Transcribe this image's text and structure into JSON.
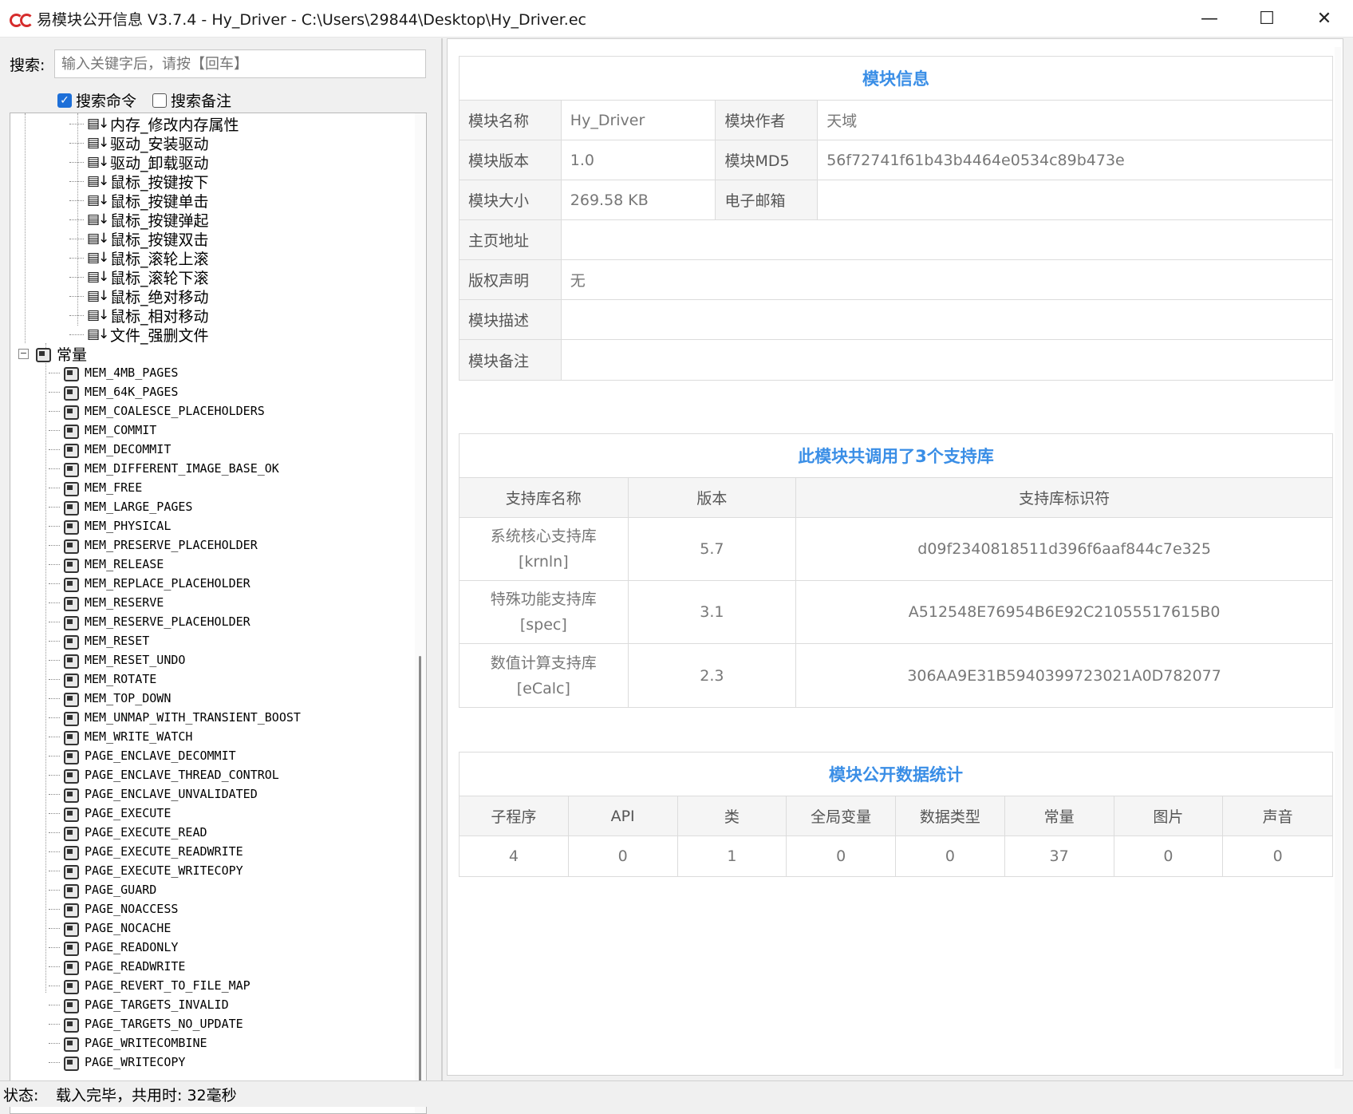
{
  "window": {
    "title": "易模块公开信息 V3.7.4 - Hy_Driver - C:\\Users\\29844\\Desktop\\Hy_Driver.ec",
    "minimize": "—",
    "maximize": "☐",
    "close": "✕"
  },
  "search": {
    "label": "搜索:",
    "placeholder": "输入关键字后，请按【回车】",
    "opt_cmd": "搜索命令",
    "opt_cmd_checked": true,
    "opt_note": "搜索备注",
    "opt_note_checked": false
  },
  "tree": {
    "commands": [
      "内存_修改内存属性",
      "驱动_安装驱动",
      "驱动_卸载驱动",
      "鼠标_按键按下",
      "鼠标_按键单击",
      "鼠标_按键弹起",
      "鼠标_按键双击",
      "鼠标_滚轮上滚",
      "鼠标_滚轮下滚",
      "鼠标_绝对移动",
      "鼠标_相对移动",
      "文件_强删文件"
    ],
    "const_group": "常量",
    "constants": [
      "MEM_4MB_PAGES",
      "MEM_64K_PAGES",
      "MEM_COALESCE_PLACEHOLDERS",
      "MEM_COMMIT",
      "MEM_DECOMMIT",
      "MEM_DIFFERENT_IMAGE_BASE_OK",
      "MEM_FREE",
      "MEM_LARGE_PAGES",
      "MEM_PHYSICAL",
      "MEM_PRESERVE_PLACEHOLDER",
      "MEM_RELEASE",
      "MEM_REPLACE_PLACEHOLDER",
      "MEM_RESERVE",
      "MEM_RESERVE_PLACEHOLDER",
      "MEM_RESET",
      "MEM_RESET_UNDO",
      "MEM_ROTATE",
      "MEM_TOP_DOWN",
      "MEM_UNMAP_WITH_TRANSIENT_BOOST",
      "MEM_WRITE_WATCH",
      "PAGE_ENCLAVE_DECOMMIT",
      "PAGE_ENCLAVE_THREAD_CONTROL",
      "PAGE_ENCLAVE_UNVALIDATED",
      "PAGE_EXECUTE",
      "PAGE_EXECUTE_READ",
      "PAGE_EXECUTE_READWRITE",
      "PAGE_EXECUTE_WRITECOPY",
      "PAGE_GUARD",
      "PAGE_NOACCESS",
      "PAGE_NOCACHE",
      "PAGE_READONLY",
      "PAGE_READWRITE",
      "PAGE_REVERT_TO_FILE_MAP",
      "PAGE_TARGETS_INVALID",
      "PAGE_TARGETS_NO_UPDATE",
      "PAGE_WRITECOMBINE",
      "PAGE_WRITECOPY"
    ]
  },
  "module_info": {
    "title": "模块信息",
    "name_label": "模块名称",
    "name": "Hy_Driver",
    "author_label": "模块作者",
    "author": "天域",
    "version_label": "模块版本",
    "version": "1.0",
    "md5_label": "模块MD5",
    "md5": "56f72741f61b43b4464e0534c89b473e",
    "size_label": "模块大小",
    "size": "269.58 KB",
    "email_label": "电子邮箱",
    "email": "",
    "homepage_label": "主页地址",
    "homepage": "",
    "copyright_label": "版权声明",
    "copyright": "无",
    "desc_label": "模块描述",
    "desc": "",
    "note_label": "模块备注",
    "note": ""
  },
  "libs": {
    "title": "此模块共调用了3个支持库",
    "headers": [
      "支持库名称",
      "版本",
      "支持库标识符"
    ],
    "rows": [
      {
        "name": "系统核心支持库",
        "code": "[krnln]",
        "version": "5.7",
        "id": "d09f2340818511d396f6aaf844c7e325"
      },
      {
        "name": "特殊功能支持库",
        "code": "[spec]",
        "version": "3.1",
        "id": "A512548E76954B6E92C21055517615B0"
      },
      {
        "name": "数值计算支持库",
        "code": "[eCalc]",
        "version": "2.3",
        "id": "306AA9E31B5940399723021A0D782077"
      }
    ]
  },
  "stats": {
    "title": "模块公开数据统计",
    "headers": [
      "子程序",
      "API",
      "类",
      "全局变量",
      "数据类型",
      "常量",
      "图片",
      "声音"
    ],
    "values": [
      "4",
      "0",
      "1",
      "0",
      "0",
      "37",
      "0",
      "0"
    ]
  },
  "status": {
    "label": "状态:",
    "text": "载入完毕，共用时: 32毫秒"
  }
}
